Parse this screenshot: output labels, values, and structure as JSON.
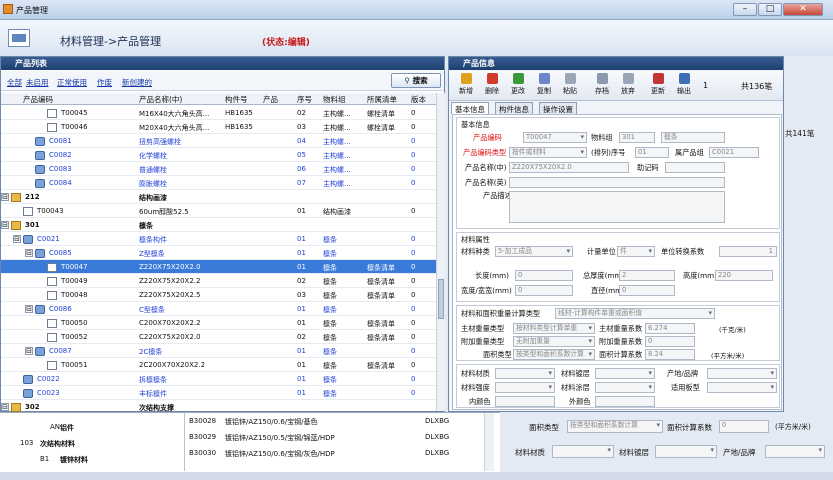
{
  "window": {
    "title": "产品管理",
    "min": "–",
    "max": "□",
    "close": "✕"
  },
  "header": {
    "title": "材料管理->产品管理",
    "status": "(状态:编辑)"
  },
  "list_panel": {
    "title": "产品列表",
    "filters": [
      "全部",
      "未启用",
      "正常使用",
      "作废",
      "新创建的"
    ],
    "search": "搜索",
    "columns": [
      "产品编码",
      "产品名称(中)",
      "构件号",
      "产品",
      "序号",
      "物料组",
      "所属清单",
      "版本"
    ],
    "rows": [
      {
        "code": "T00045",
        "name": "M16X40大六角头高...",
        "part": "HB1635",
        "seq": "02",
        "grp": "主构螺...",
        "list": "螺栓清单",
        "ver": "0",
        "lvl": 4,
        "icon": "doc"
      },
      {
        "code": "T00046",
        "name": "M20X40大六角头高...",
        "part": "HB1635",
        "seq": "03",
        "grp": "主构螺...",
        "list": "螺栓清单",
        "ver": "0",
        "lvl": 4,
        "icon": "doc"
      },
      {
        "code": "C0081",
        "name": "扭剪高强螺栓",
        "part": "",
        "seq": "04",
        "grp": "主构螺...",
        "list": "",
        "ver": "0",
        "lvl": 3,
        "icon": "grp",
        "blue": true
      },
      {
        "code": "C0082",
        "name": "化学螺栓",
        "part": "",
        "seq": "05",
        "grp": "主构螺...",
        "list": "",
        "ver": "0",
        "lvl": 3,
        "icon": "grp",
        "blue": true
      },
      {
        "code": "C0083",
        "name": "普通螺栓",
        "part": "",
        "seq": "06",
        "grp": "主构螺...",
        "list": "",
        "ver": "0",
        "lvl": 3,
        "icon": "grp",
        "blue": true
      },
      {
        "code": "C0084",
        "name": "膨胀螺栓",
        "part": "",
        "seq": "07",
        "grp": "主构螺...",
        "list": "",
        "ver": "0",
        "lvl": 3,
        "icon": "grp",
        "blue": true
      },
      {
        "code": "212",
        "name": "结构画漆",
        "part": "",
        "seq": "",
        "grp": "",
        "list": "",
        "ver": "",
        "lvl": 1,
        "icon": "fold",
        "bold": true,
        "tg": "⊟"
      },
      {
        "code": "T00043",
        "name": "60um醇酸52.5",
        "part": "",
        "seq": "01",
        "grp": "结构画漆",
        "list": "",
        "ver": "0",
        "lvl": 2,
        "icon": "doc"
      },
      {
        "code": "301",
        "name": "檩条",
        "part": "",
        "seq": "",
        "grp": "",
        "list": "",
        "ver": "",
        "lvl": 1,
        "icon": "fold",
        "bold": true,
        "tg": "⊟"
      },
      {
        "code": "C0021",
        "name": "檩条构件",
        "part": "",
        "seq": "01",
        "grp": "檩条",
        "list": "",
        "ver": "0",
        "lvl": 2,
        "icon": "grp",
        "blue": true,
        "tg": "⊟"
      },
      {
        "code": "C0085",
        "name": "Z型檩条",
        "part": "",
        "seq": "01",
        "grp": "檩条",
        "list": "",
        "ver": "0",
        "lvl": 3,
        "icon": "grp",
        "blue": true,
        "tg": "⊟"
      },
      {
        "code": "T00047",
        "name": "Z220X75X20X2.0",
        "part": "",
        "seq": "01",
        "grp": "檩条",
        "list": "檩条清单",
        "ver": "0",
        "lvl": 4,
        "icon": "doc",
        "sel": true
      },
      {
        "code": "T00049",
        "name": "Z220X75X20X2.2",
        "part": "",
        "seq": "02",
        "grp": "檩条",
        "list": "檩条清单",
        "ver": "0",
        "lvl": 4,
        "icon": "doc"
      },
      {
        "code": "T00048",
        "name": "Z220X75X20X2.5",
        "part": "",
        "seq": "03",
        "grp": "檩条",
        "list": "檩条清单",
        "ver": "0",
        "lvl": 4,
        "icon": "doc"
      },
      {
        "code": "C0086",
        "name": "C型檩条",
        "part": "",
        "seq": "01",
        "grp": "檩条",
        "list": "",
        "ver": "0",
        "lvl": 3,
        "icon": "grp",
        "blue": true,
        "tg": "⊟"
      },
      {
        "code": "T00050",
        "name": "C200X70X20X2.2",
        "part": "",
        "seq": "01",
        "grp": "檩条",
        "list": "檩条清单",
        "ver": "0",
        "lvl": 4,
        "icon": "doc"
      },
      {
        "code": "T00052",
        "name": "C220X75X20X2.0",
        "part": "",
        "seq": "02",
        "grp": "檩条",
        "list": "檩条清单",
        "ver": "0",
        "lvl": 4,
        "icon": "doc"
      },
      {
        "code": "C0087",
        "name": "2C檩条",
        "part": "",
        "seq": "01",
        "grp": "檩条",
        "list": "",
        "ver": "0",
        "lvl": 3,
        "icon": "grp",
        "blue": true,
        "tg": "⊟"
      },
      {
        "code": "T00051",
        "name": "2C200X70X20X2.2",
        "part": "",
        "seq": "01",
        "grp": "檩条",
        "list": "檩条清单",
        "ver": "0",
        "lvl": 4,
        "icon": "doc"
      },
      {
        "code": "C0022",
        "name": "拆檩檩条",
        "part": "",
        "seq": "01",
        "grp": "檩条",
        "list": "",
        "ver": "0",
        "lvl": 2,
        "icon": "grp",
        "blue": true
      },
      {
        "code": "C0023",
        "name": "丰标檩件",
        "part": "",
        "seq": "01",
        "grp": "檩条",
        "list": "",
        "ver": "0",
        "lvl": 2,
        "icon": "grp",
        "blue": true
      },
      {
        "code": "302",
        "name": "次结构支撑",
        "part": "",
        "seq": "",
        "grp": "",
        "list": "",
        "ver": "",
        "lvl": 1,
        "icon": "fold",
        "bold": true,
        "tg": "⊟"
      }
    ]
  },
  "info_panel": {
    "title": "产品信息",
    "toolbar": [
      "新增",
      "删除",
      "更改",
      "复制",
      "粘贴",
      "存档",
      "放弃",
      "更新",
      "输出"
    ],
    "page": "1",
    "total": "共136笔",
    "tabs": [
      "基本信息",
      "构件信息",
      "操作设置"
    ],
    "basic": {
      "legend": "基本信息",
      "code_label": "产品编码",
      "code": "T00047",
      "group_label": "物料组",
      "group_code": "301",
      "group_name": "檩条",
      "type_label": "产品编码类型",
      "type": "按件或材料",
      "seq_label": "(排列)序号",
      "seq": "01",
      "pgroup_label": "属产品组",
      "pgroup": "C0021",
      "name_cn_label": "产品名称(中)",
      "name_cn": "Z220X75X20X2.0",
      "mnem_label": "助记码",
      "name_en_label": "产品名称(英)",
      "desc_label": "产品描述"
    },
    "attr": {
      "legend": "材料属性",
      "kind_label": "材料种类",
      "kind": "5-加工成品",
      "unit_label": "计量单位",
      "unit": "件",
      "conv_label": "单位转换系数",
      "conv": "1",
      "len_label": "长度(mm)",
      "len": "0",
      "th_label": "总厚度(mm)",
      "th": "2",
      "h_label": "高度(mm)",
      "h": "220",
      "w_label": "宽度/宽宽(mm)",
      "w": "0",
      "d_label": "直径(mm)",
      "d": "0"
    },
    "weight": {
      "calc_label": "材料和面积重量计算类型",
      "calc": "线材-计算构件单重或面积值",
      "main_type_label": "主材重量类型",
      "main_type": "按材料类型计算单重",
      "main_coef_label": "主材重量系数",
      "main_coef": "6.274",
      "main_unit": "(千克/米)",
      "add_type_label": "附加重量类型",
      "add_type": "无附加重量",
      "add_coef_label": "附加重量系数",
      "add_coef": "0",
      "area_type_label": "面积类型",
      "area_type": "按类型和面积系数计算",
      "area_coef_label": "面积计算系数",
      "area_coef": "8.24",
      "area_unit": "(平方米/米)"
    },
    "material": {
      "mat_label": "材料材质",
      "plate_label": "材料镀层",
      "origin_label": "产地/品牌",
      "str_label": "材料强度",
      "coat_label": "材料涂层",
      "fit_label": "适用板型",
      "inner_label": "内颜色",
      "outer_label": "外颜色"
    }
  },
  "bottom": {
    "left_rows": [
      {
        "code": "AN",
        "name": "铝件"
      },
      {
        "code": "103",
        "name": "次结构材料"
      },
      {
        "code": "B1",
        "name": "镀锌材料"
      }
    ],
    "mid_rows": [
      {
        "code": "B30028",
        "name": "镀铝锌/AZ150/0.6/宝钢/基色",
        "tag": "DLXBG"
      },
      {
        "code": "B30029",
        "name": "镀铝锌/AZ150/0.5/宝钢/锦蓝/HDP",
        "tag": "DLXBG"
      },
      {
        "code": "B30030",
        "name": "镀铝锌/AZ150/0.6/宝钢/灰色/HDP",
        "tag": "DLXBG"
      }
    ],
    "right_area_label": "面积类型",
    "right_area": "按类型和面积系数计算",
    "right_coef_label": "面积计算系数",
    "right_coef": "0",
    "right_unit": "(平方米/米)",
    "right_mat": "材料材质",
    "right_plate": "材料镀层",
    "right_origin": "产地/品牌",
    "bg_total": "共141笔"
  },
  "colors": {
    "accent": "#1d3f70",
    "selected": "#3a7ad8",
    "link": "#1537a8",
    "status": "#c81e1e"
  }
}
